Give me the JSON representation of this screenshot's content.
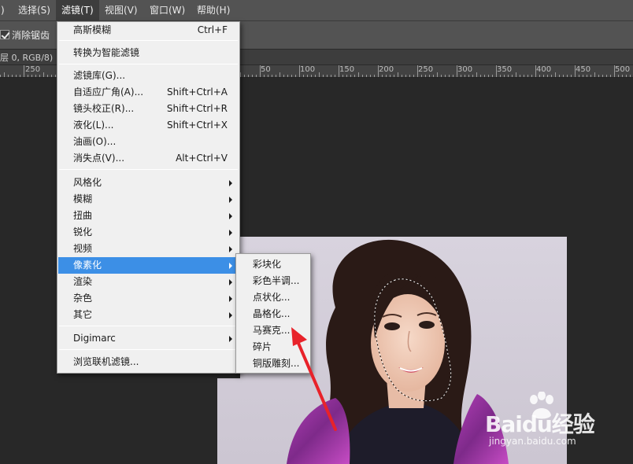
{
  "menubar": {
    "items": [
      {
        "label": ")"
      },
      {
        "label": "选择(S)"
      },
      {
        "label": "滤镜(T)"
      },
      {
        "label": "视图(V)"
      },
      {
        "label": "窗口(W)"
      },
      {
        "label": "帮助(H)"
      }
    ]
  },
  "options": {
    "antialias_label": "消除锯齿"
  },
  "doc_tab": {
    "text": "层 0, RGB/8)"
  },
  "ruler": {
    "labels": [
      "250",
      "50",
      "100",
      "150",
      "200",
      "250",
      "300",
      "350",
      "400",
      "450",
      "500"
    ]
  },
  "filter_menu": {
    "last_filter": {
      "label": "高斯模糊",
      "shortcut": "Ctrl+F"
    },
    "smart": {
      "label": "转换为智能滤镜"
    },
    "gallery": {
      "label": "滤镜库(G)..."
    },
    "adaptive": {
      "label": "自适应广角(A)...",
      "shortcut": "Shift+Ctrl+A"
    },
    "lens": {
      "label": "镜头校正(R)...",
      "shortcut": "Shift+Ctrl+R"
    },
    "liquify": {
      "label": "液化(L)...",
      "shortcut": "Shift+Ctrl+X"
    },
    "oil": {
      "label": "油画(O)..."
    },
    "vanish": {
      "label": "消失点(V)...",
      "shortcut": "Alt+Ctrl+V"
    },
    "stylize": {
      "label": "风格化"
    },
    "blur": {
      "label": "模糊"
    },
    "distort": {
      "label": "扭曲"
    },
    "sharpen": {
      "label": "锐化"
    },
    "video": {
      "label": "视频"
    },
    "pixelate": {
      "label": "像素化"
    },
    "render": {
      "label": "渲染"
    },
    "noise": {
      "label": "杂色"
    },
    "other": {
      "label": "其它"
    },
    "digimarc": {
      "label": "Digimarc"
    },
    "browse": {
      "label": "浏览联机滤镜..."
    }
  },
  "pixelate_submenu": {
    "items": [
      {
        "label": "彩块化"
      },
      {
        "label": "彩色半调..."
      },
      {
        "label": "点状化..."
      },
      {
        "label": "晶格化..."
      },
      {
        "label": "马赛克..."
      },
      {
        "label": "碎片"
      },
      {
        "label": "铜版雕刻..."
      }
    ]
  },
  "watermark": {
    "brand": "Baidu经验",
    "url": "jingyan.baidu.com"
  },
  "colors": {
    "highlight": "#3c8fe6",
    "menubar": "#535353",
    "menu_bg": "#f0f0f0",
    "arrow": "#e8222a"
  }
}
